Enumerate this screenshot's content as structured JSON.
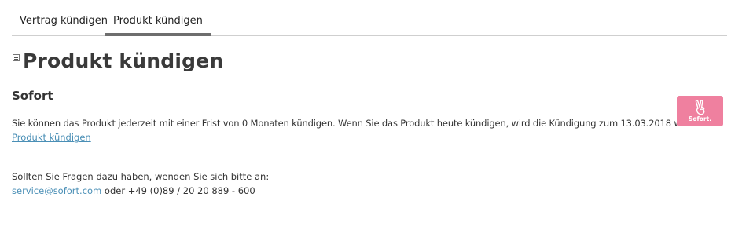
{
  "tabs": [
    {
      "label": "Vertrag kündigen",
      "active": false
    },
    {
      "label": "Produkt kündigen",
      "active": true
    }
  ],
  "page_title": "Produkt kündigen",
  "section": {
    "title": "Sofort",
    "description": "Sie können das Produkt jederzeit mit einer Frist von 0 Monaten kündigen. Wenn Sie das Produkt heute kündigen, wird die Kündigung zum 13.03.2018 wirksam.",
    "cancel_link": "Produkt kündigen"
  },
  "help": {
    "text": "Sollten Sie Fragen dazu haben, wenden Sie sich bitte an:",
    "email": "service@sofort.com",
    "connector": " oder ",
    "phone": "+49 (0)89 / 20 20 889 - 600"
  },
  "logo": {
    "brand": "Sofort.",
    "icon": "victory-hand-icon",
    "color": "#ef809f"
  },
  "colors": {
    "link": "#4a8fb6",
    "active_tab_underline": "#6e6e6e"
  }
}
